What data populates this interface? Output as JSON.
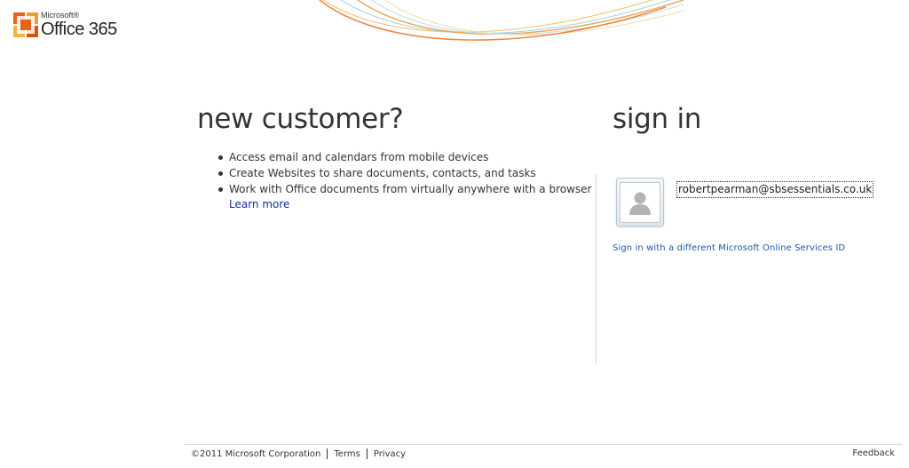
{
  "brand": {
    "company": "Microsoft®",
    "product": "Office 365"
  },
  "new_customer": {
    "title": "new customer?",
    "benefits": [
      "Access email and calendars from mobile devices",
      "Create Websites to share documents, contacts, and tasks",
      "Work with Office documents from virtually anywhere with a browser"
    ],
    "learn_more": "Learn more"
  },
  "sign_in": {
    "title": "sign in",
    "account_id": "robertpearman@sbsessentials.co.uk",
    "user_tile_icon": "user-silhouette-icon",
    "different_id_link": "Sign in with a different Microsoft Online Services ID"
  },
  "footer": {
    "copyright": "©2011 Microsoft Corporation",
    "terms": "Terms",
    "privacy": "Privacy",
    "feedback": "Feedback"
  },
  "colors": {
    "link_blue": "#0b2fa8",
    "link_alt_blue": "#1a5aa8",
    "text": "#333333",
    "logo_orange": "#e8641b"
  }
}
